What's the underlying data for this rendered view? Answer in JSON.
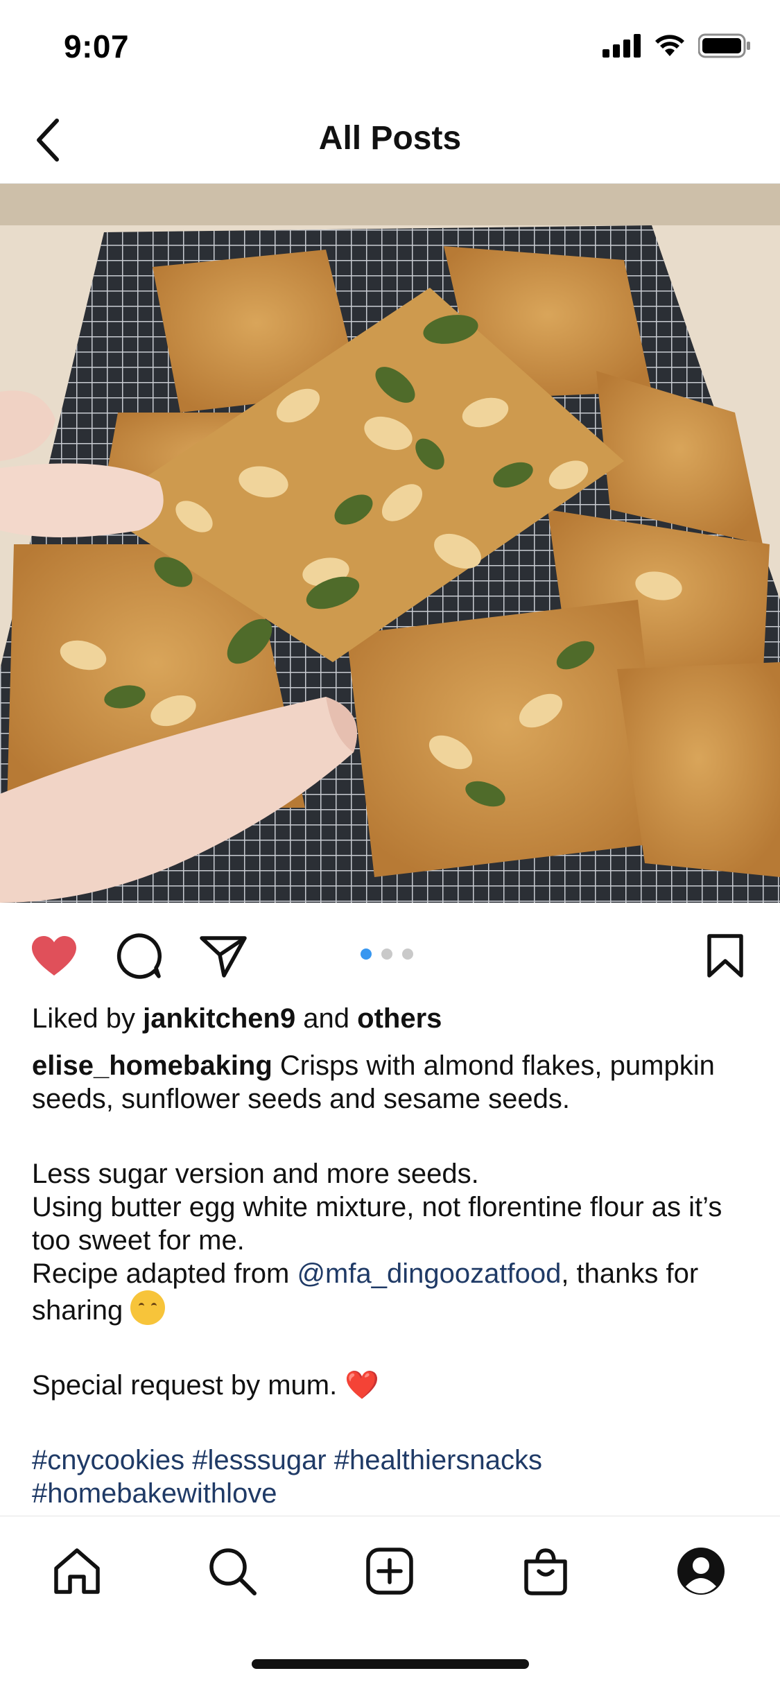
{
  "status_bar": {
    "time": "9:07"
  },
  "header": {
    "title": "All Posts"
  },
  "carousel": {
    "total": 3,
    "active_index": 0
  },
  "post": {
    "liked_by_prefix": "Liked by ",
    "liked_by_user": "jankitchen9",
    "liked_by_and": " and ",
    "liked_by_others": "others",
    "username": "elise_homebaking",
    "caption_line1": " Crisps with almond flakes, pumpkin seeds, sunflower seeds and sesame seeds.",
    "caption_line2": "Less sugar version and more seeds.",
    "caption_line3": "Using butter egg white mixture, not florentine flour as it’s too sweet for me.",
    "caption_recipe_prefix": "Recipe adapted from ",
    "caption_mention": "@mfa_dingoozatfood",
    "caption_recipe_suffix": ", thanks for sharing ",
    "caption_special": "Special request by mum. ",
    "heart_emoji": "❤️",
    "hashtags": "#cnycookies #lesssugar #healthiersnacks #homebakewithlove"
  },
  "colors": {
    "like_red": "#e0505a",
    "link_blue": "#1f3a66",
    "active_dot": "#3897f0"
  },
  "icons": [
    "back-chevron-icon",
    "heart-filled-icon",
    "comment-icon",
    "share-icon",
    "bookmark-icon",
    "home-icon",
    "search-icon",
    "add-post-icon",
    "shop-icon",
    "profile-icon"
  ]
}
